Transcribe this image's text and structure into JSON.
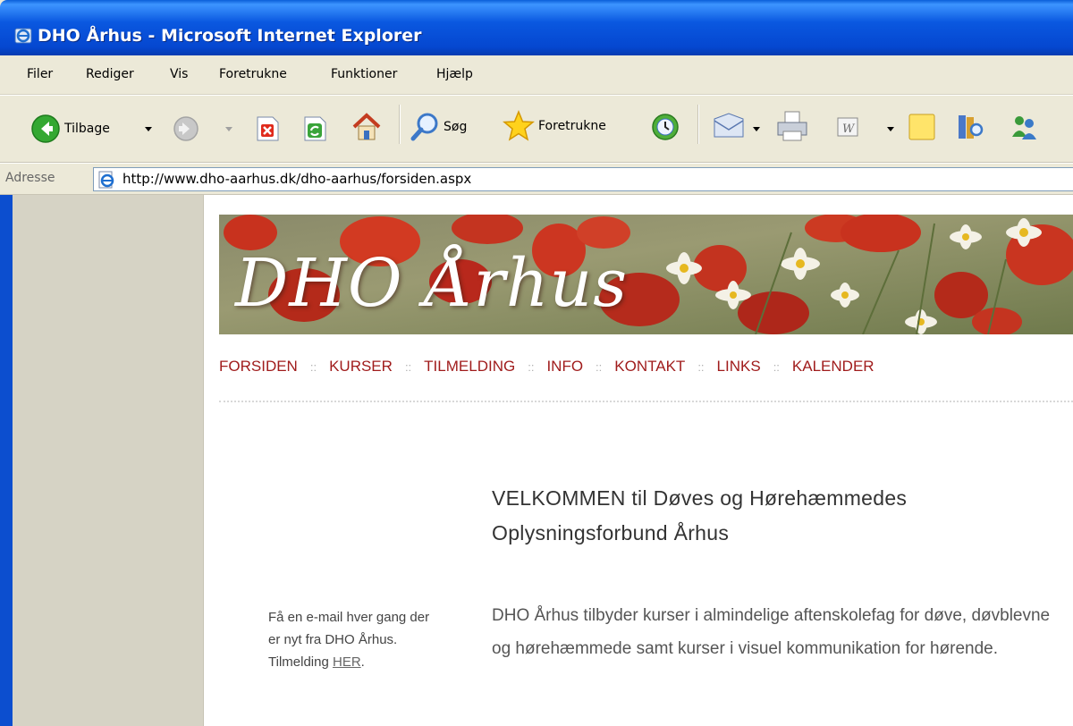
{
  "window": {
    "title": "DHO Århus - Microsoft Internet Explorer"
  },
  "menu": {
    "items": [
      "Filer",
      "Rediger",
      "Vis",
      "Foretrukne",
      "Funktioner",
      "Hjælp"
    ]
  },
  "toolbar": {
    "back_label": "Tilbage",
    "search_label": "Søg",
    "favorites_label": "Foretrukne"
  },
  "address": {
    "label": "Adresse",
    "url": "http://www.dho-aarhus.dk/dho-aarhus/forsiden.aspx"
  },
  "page": {
    "banner_title": "DHO Århus",
    "nav": [
      "FORSIDEN",
      "KURSER",
      "TILMELDING",
      "INFO",
      "KONTAKT",
      "LINKS",
      "KALENDER"
    ],
    "nav_separator": "::",
    "welcome_heading": "VELKOMMEN til Døves og Hørehæmmedes Oplysningsforbund Århus",
    "intro_text": "DHO Århus tilbyder kurser i almindelige aftenskolefag for døve, døvblevne og hørehæmmede samt kurser i visuel kommunikation for hørende.",
    "newsletter_text": "Få en e-mail hver gang der er nyt fra DHO Århus. Tilmelding",
    "newsletter_link": "HER",
    "newsletter_end": "."
  },
  "colors": {
    "titlebar_blue": "#0a58e0",
    "nav_red": "#a01c1c",
    "chrome": "#ece9d8"
  }
}
